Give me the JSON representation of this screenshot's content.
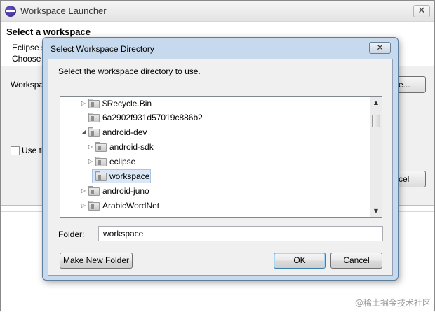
{
  "background_window": {
    "title": "Workspace Launcher",
    "close_glyph": "✕",
    "heading": "Select a workspace",
    "desc_line1": "Eclipse s",
    "desc_line2": "Choose",
    "workspace_label": "Workspa",
    "browse_label": "e...",
    "checkbox_label": "Use th",
    "cancel_label": "cel"
  },
  "dialog": {
    "title": "Select Workspace Directory",
    "close_glyph": "✕",
    "instruction": "Select the workspace directory to use.",
    "tree": [
      {
        "label": "$Recycle.Bin",
        "expander": "▷",
        "selected": false
      },
      {
        "label": "6a2902f931d57019c886b2",
        "expander": "",
        "selected": false
      },
      {
        "label": "android-dev",
        "expander": "◢",
        "selected": false
      },
      {
        "label": "android-sdk",
        "expander": "▷",
        "selected": false
      },
      {
        "label": "eclipse",
        "expander": "▷",
        "selected": false
      },
      {
        "label": "workspace",
        "expander": "",
        "selected": true
      },
      {
        "label": "android-juno",
        "expander": "▷",
        "selected": false
      },
      {
        "label": "ArabicWordNet",
        "expander": "▷",
        "selected": false
      }
    ],
    "folder_label": "Folder:",
    "folder_value": "workspace",
    "buttons": {
      "make_new_folder": "Make New Folder",
      "ok": "OK",
      "cancel": "Cancel"
    }
  },
  "watermark": "@稀土掘金技术社区"
}
